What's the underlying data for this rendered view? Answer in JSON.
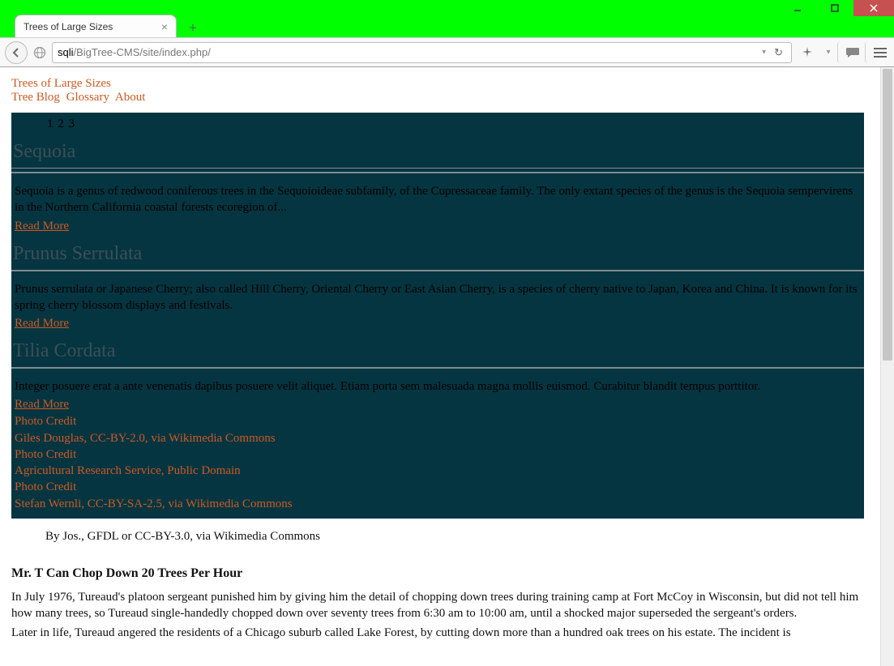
{
  "window": {
    "tab_title": "Trees of Large Sizes",
    "url_prefix": "sqli",
    "url_rest": "/BigTree-CMS/site/index.php/"
  },
  "site": {
    "title": "Trees of Large Sizes",
    "nav": [
      "Tree Blog",
      "Glossary",
      "About"
    ]
  },
  "pager": [
    "1",
    "2",
    "3"
  ],
  "slides": [
    {
      "title": "Sequoia",
      "desc": "Sequoia is a genus of redwood coniferous trees in the Sequoioideae subfamily, of the Cupressaceae family. The only extant species of the genus is the Sequoia sempervirens in the Northern California coastal forests ecoregion of...",
      "read_more": "Read More"
    },
    {
      "title": "Prunus Serrulata",
      "desc": "Prunus serrulata or Japanese Cherry; also called Hill Cherry, Oriental Cherry or East Asian Cherry, is a species of cherry native to Japan, Korea and China. It is known for its spring cherry blossom displays and festivals.",
      "read_more": "Read More"
    },
    {
      "title": "Tilia Cordata",
      "desc": "Integer posuere erat a ante venenatis dapibus posuere velit aliquet. Etiam porta sem malesuada magna mollis euismod. Curabitur blandit tempus porttitor.",
      "read_more": "Read More"
    }
  ],
  "credits": [
    {
      "label": "Photo Credit",
      "attribution": "Giles Douglas, CC-BY-2.0, via Wikimedia Commons"
    },
    {
      "label": "Photo Credit",
      "attribution": "Agricultural Research Service, Public Domain"
    },
    {
      "label": "Photo Credit",
      "attribution": "Stefan Wernli, CC-BY-SA-2.5, via Wikimedia Commons"
    }
  ],
  "caption": "By Jos., GFDL or CC-BY-3.0, via Wikimedia Commons",
  "article": {
    "title": "Mr. T Can Chop Down 20 Trees Per Hour",
    "p1": "In July 1976, Tureaud's platoon sergeant punished him by giving him the detail of chopping down trees during training camp at Fort McCoy in Wisconsin, but did not tell him how many trees, so Tureaud single-handedly chopped down over seventy trees from 6:30 am to 10:00 am, until a shocked major superseded the sergeant's orders.",
    "p2": "Later in life, Tureaud angered the residents of a Chicago suburb called Lake Forest, by cutting down more than a hundred oak trees on his estate. The incident is"
  }
}
